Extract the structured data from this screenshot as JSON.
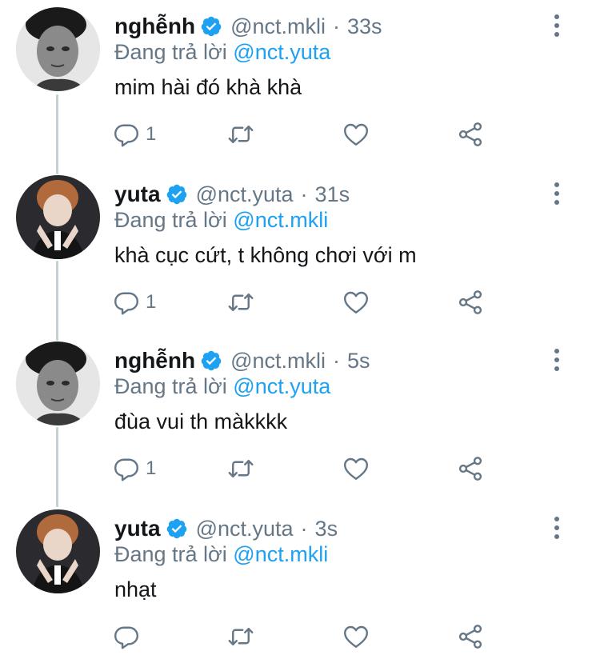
{
  "tweets": [
    {
      "name": "nghễnh",
      "handle": "@nct.mkli",
      "time": "33s",
      "reply_prefix": "Đang trả lời",
      "reply_to": "@nct.yuta",
      "text": "mim hài đó khà khà",
      "reply_count": "1"
    },
    {
      "name": "yuta",
      "handle": "@nct.yuta",
      "time": "31s",
      "reply_prefix": "Đang trả lời",
      "reply_to": "@nct.mkli",
      "text": "khà cục cứt, t không chơi với m",
      "reply_count": "1"
    },
    {
      "name": "nghễnh",
      "handle": "@nct.mkli",
      "time": "5s",
      "reply_prefix": "Đang trả lời",
      "reply_to": "@nct.yuta",
      "text": "đùa vui th màkkkk",
      "reply_count": "1"
    },
    {
      "name": "yuta",
      "handle": "@nct.yuta",
      "time": "3s",
      "reply_prefix": "Đang trả lời",
      "reply_to": "@nct.mkli",
      "text": "nhạt",
      "reply_count": ""
    }
  ],
  "separator": "·",
  "icons": {
    "verified": "verified-badge-icon",
    "more": "more-vertical-icon",
    "reply": "reply-icon",
    "retweet": "retweet-icon",
    "like": "like-heart-icon",
    "share": "share-icon"
  },
  "colors": {
    "text": "#14171a",
    "secondary": "#657786",
    "mention": "#1da1f2",
    "verified": "#1da1f2",
    "thread_line": "#c4cfd6"
  }
}
